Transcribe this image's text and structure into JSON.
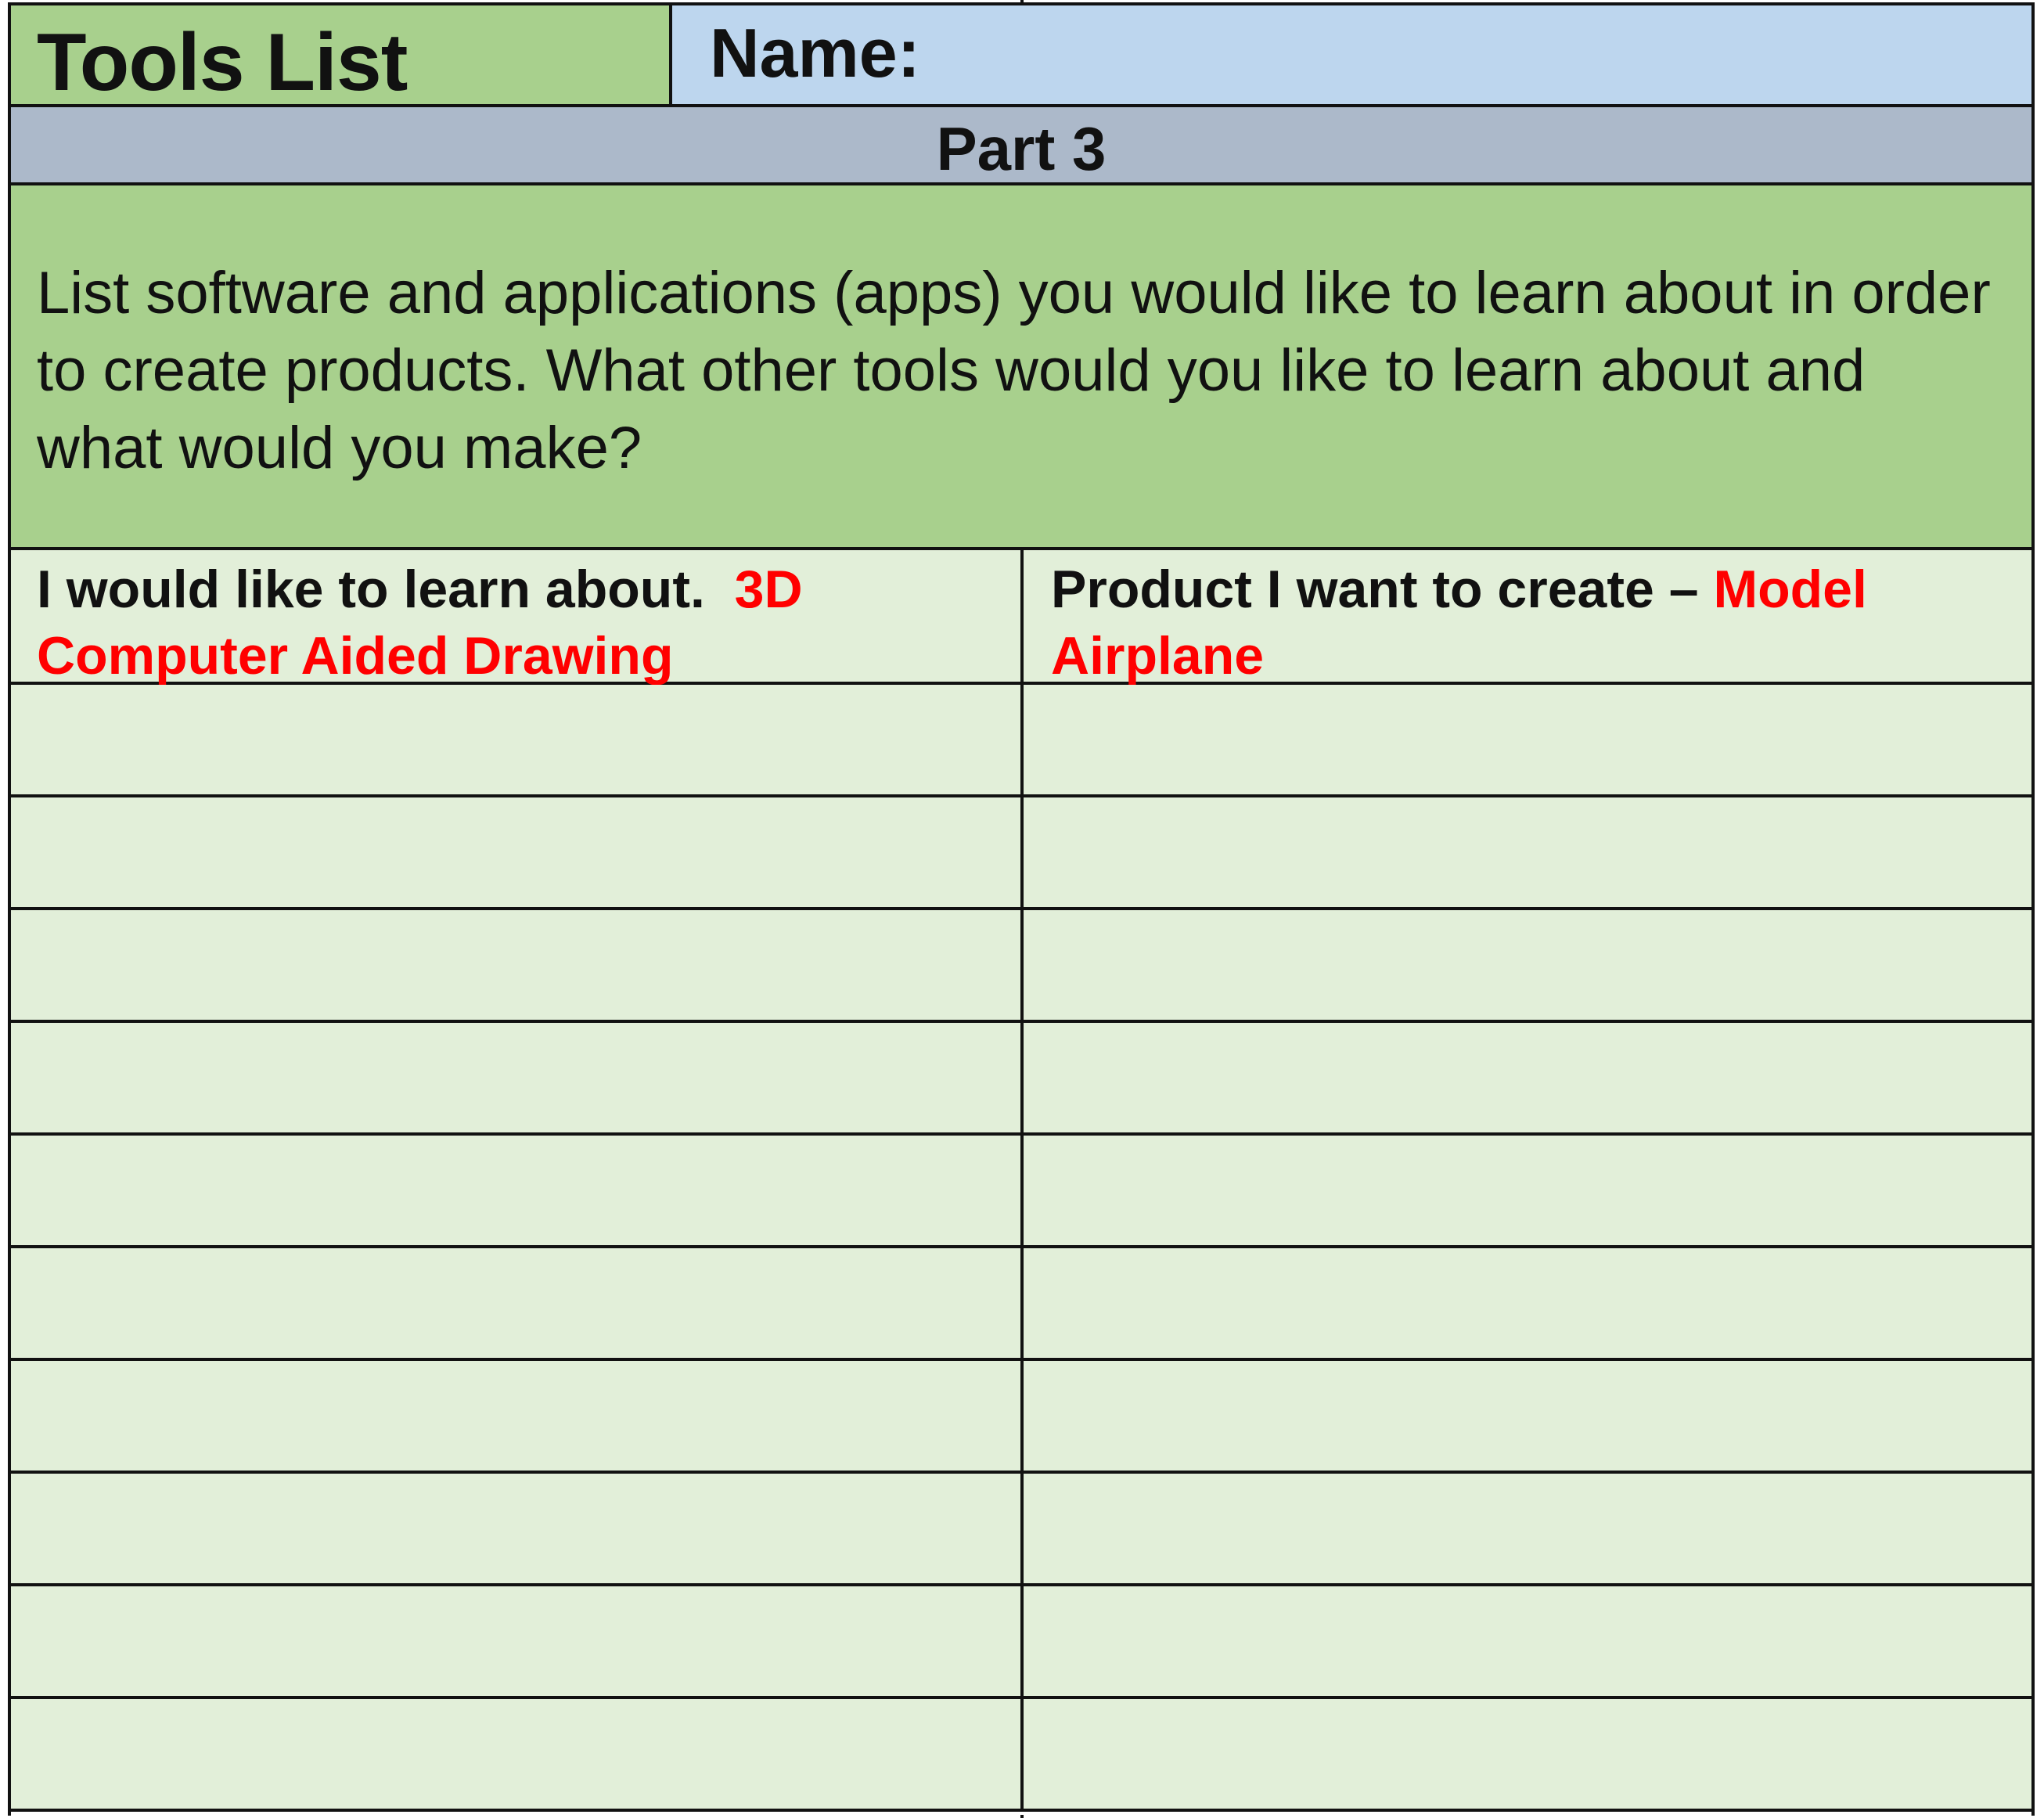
{
  "header": {
    "title": "Tools List",
    "name_label": "Name:"
  },
  "section": {
    "label": "Part 3"
  },
  "instructions": {
    "text": "List software and applications (apps) you would like to learn about in order to create products. What other tools would you like to learn about and what would you make?"
  },
  "columns": {
    "left": {
      "label": "I would like to learn about.",
      "example": "3D Computer Aided Drawing"
    },
    "right": {
      "label": "Product I want to create –",
      "example": "Model Airplane"
    }
  },
  "entries": [
    {
      "learn": "",
      "product": ""
    },
    {
      "learn": "",
      "product": ""
    },
    {
      "learn": "",
      "product": ""
    },
    {
      "learn": "",
      "product": ""
    },
    {
      "learn": "",
      "product": ""
    },
    {
      "learn": "",
      "product": ""
    },
    {
      "learn": "",
      "product": ""
    },
    {
      "learn": "",
      "product": ""
    },
    {
      "learn": "",
      "product": ""
    },
    {
      "learn": "",
      "product": ""
    }
  ],
  "colors": {
    "title_bg": "#a8d08d",
    "name_bg": "#bdd6ee",
    "section_bg": "#acb9ca",
    "table_bg": "#e2efd9",
    "example_text": "#ff0000"
  }
}
